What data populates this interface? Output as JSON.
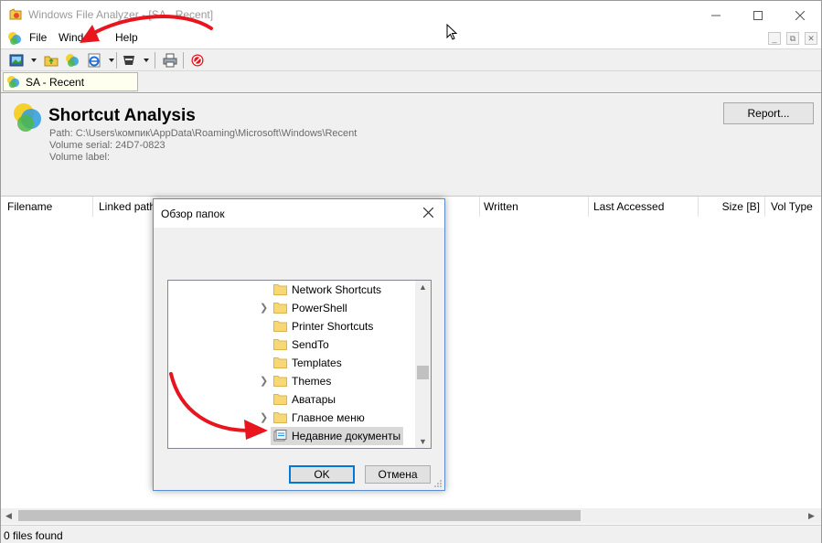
{
  "window": {
    "title": "Windows File Analyzer - [SA - Recent]",
    "accent_red": "#e8141e"
  },
  "menu": {
    "items": [
      "File",
      "Window",
      "Help"
    ],
    "mdi_controls": [
      "_",
      "⧉",
      "✕"
    ]
  },
  "toolbar": {
    "icons": [
      "picture-icon",
      "recycle-folder-icon",
      "shortcut-analysis-icon",
      "ie-icon",
      "ninja-icon",
      "print-icon",
      "stop-icon"
    ]
  },
  "tab": {
    "label": "SA - Recent"
  },
  "header": {
    "title": "Shortcut Analysis",
    "path": "Path: C:\\Users\\компик\\AppData\\Roaming\\Microsoft\\Windows\\Recent",
    "volume_serial": "Volume serial:  24D7-0823",
    "volume_label": "Volume label:",
    "report_button": "Report..."
  },
  "list": {
    "columns": [
      "Filename",
      "Linked path",
      "Written",
      "Last Accessed",
      "Size [B]",
      "Vol Type"
    ]
  },
  "status": {
    "text": "0 files found"
  },
  "dialog": {
    "title": "Обзор папок",
    "items": [
      {
        "name": "Network Shortcuts",
        "expandable": false,
        "selected": false
      },
      {
        "name": "PowerShell",
        "expandable": true,
        "selected": false
      },
      {
        "name": "Printer Shortcuts",
        "expandable": false,
        "selected": false
      },
      {
        "name": "SendTo",
        "expandable": false,
        "selected": false
      },
      {
        "name": "Templates",
        "expandable": false,
        "selected": false
      },
      {
        "name": "Themes",
        "expandable": true,
        "selected": false
      },
      {
        "name": "Аватары",
        "expandable": false,
        "selected": false
      },
      {
        "name": "Главное меню",
        "expandable": true,
        "selected": false
      },
      {
        "name": "Недавние документы",
        "expandable": false,
        "selected": true
      }
    ],
    "ok_label": "OK",
    "cancel_label": "Отмена"
  }
}
